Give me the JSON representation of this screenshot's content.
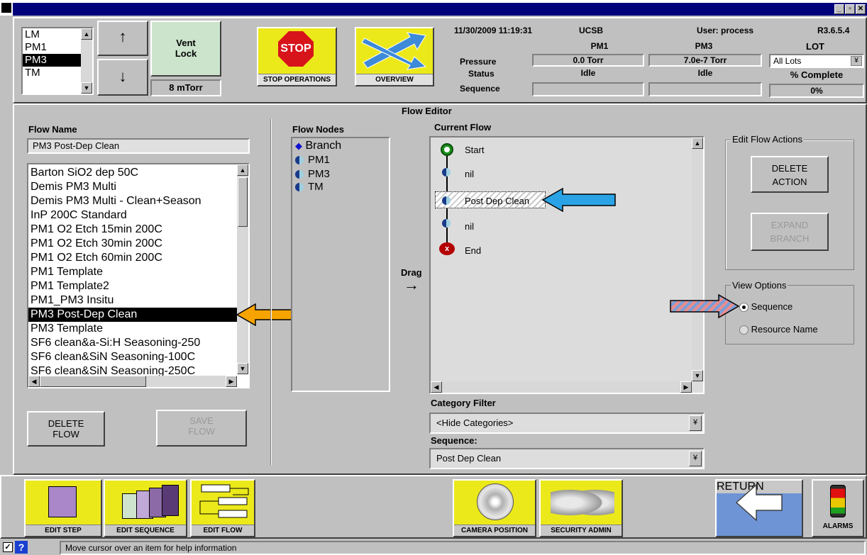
{
  "window": {
    "min": "_",
    "max": "▫",
    "close": "✕"
  },
  "header": {
    "chambers": [
      "LM",
      "PM1",
      "PM3",
      "TM"
    ],
    "selected_chamber": "PM3",
    "vent_lock_label_1": "Vent",
    "vent_lock_label_2": "Lock",
    "pressure_readout": "8 mTorr",
    "stop_label": "STOP",
    "stop_caption": "STOP OPERATIONS",
    "overview_caption": "OVERVIEW",
    "datetime": "11/30/2009  11:19:31",
    "site": "UCSB",
    "user": "User: process",
    "version": "R3.6.5.4",
    "col_pm1": "PM1",
    "col_pm3": "PM3",
    "col_lot": "LOT",
    "row_pressure": "Pressure",
    "row_status": "Status",
    "row_sequence": "Sequence",
    "pm1_pressure": "0.0 Torr",
    "pm3_pressure": "7.0e-7  Torr",
    "pm1_status": "Idle",
    "pm3_status": "Idle",
    "lot_select": "All Lots",
    "pct_label": "% Complete",
    "pct_value": "0%"
  },
  "editor": {
    "title": "Flow Editor",
    "flow_name_label": "Flow Name",
    "flow_name_value": "PM3 Post-Dep Clean",
    "flows": [
      "Barton SiO2 dep 50C",
      "Demis PM3 Multi",
      "Demis PM3 Multi - Clean+Season",
      "InP 200C Standard",
      "PM1 O2 Etch 15min 200C",
      "PM1 O2 Etch 30min 200C",
      "PM1 O2 Etch 60min 200C",
      "PM1 Template",
      "PM1 Template2",
      "PM1_PM3 Insitu",
      "PM3 Post-Dep Clean",
      "PM3 Template",
      "SF6 clean&a-Si:H Seasoning-250",
      "SF6 clean&SiN Seasoning-100C",
      "SF6 clean&SiN Seasoning-250C"
    ],
    "selected_flow": "PM3 Post-Dep Clean",
    "delete_flow_1": "DELETE",
    "delete_flow_2": "FLOW",
    "save_flow_1": "SAVE",
    "save_flow_2": "FLOW",
    "flow_nodes_label": "Flow Nodes",
    "nodes": [
      "Branch",
      "PM1",
      "PM3",
      "TM"
    ],
    "drag_label": "Drag",
    "current_flow_label": "Current Flow",
    "steps": [
      "Start",
      "nil",
      "Post Dep Clean",
      "nil",
      "End"
    ],
    "edit_actions_label": "Edit Flow Actions",
    "delete_action_1": "DELETE",
    "delete_action_2": "ACTION",
    "expand_branch_1": "EXPAND",
    "expand_branch_2": "BRANCH",
    "view_options_label": "View Options",
    "opt_sequence": "Sequence",
    "opt_resource": "Resource Name",
    "category_filter_label": "Category Filter",
    "category_value": "<Hide Categories>",
    "sequence_label": "Sequence:",
    "sequence_value": "Post Dep Clean"
  },
  "toolbar": {
    "edit_step": "EDIT STEP",
    "edit_sequence": "EDIT SEQUENCE",
    "edit_flow": "EDIT FLOW",
    "camera_position": "CAMERA POSITION",
    "security_admin": "SECURITY ADMIN",
    "return": "RETURN",
    "alarms": "ALARMS"
  },
  "status_bar": {
    "help": "Move cursor over an item for help information"
  },
  "colors": {
    "palette_yellow": "#ece91b",
    "title_blue": "#00007b",
    "arrow_orange": "#f7a400",
    "arrow_blue": "#2aa3e6"
  }
}
